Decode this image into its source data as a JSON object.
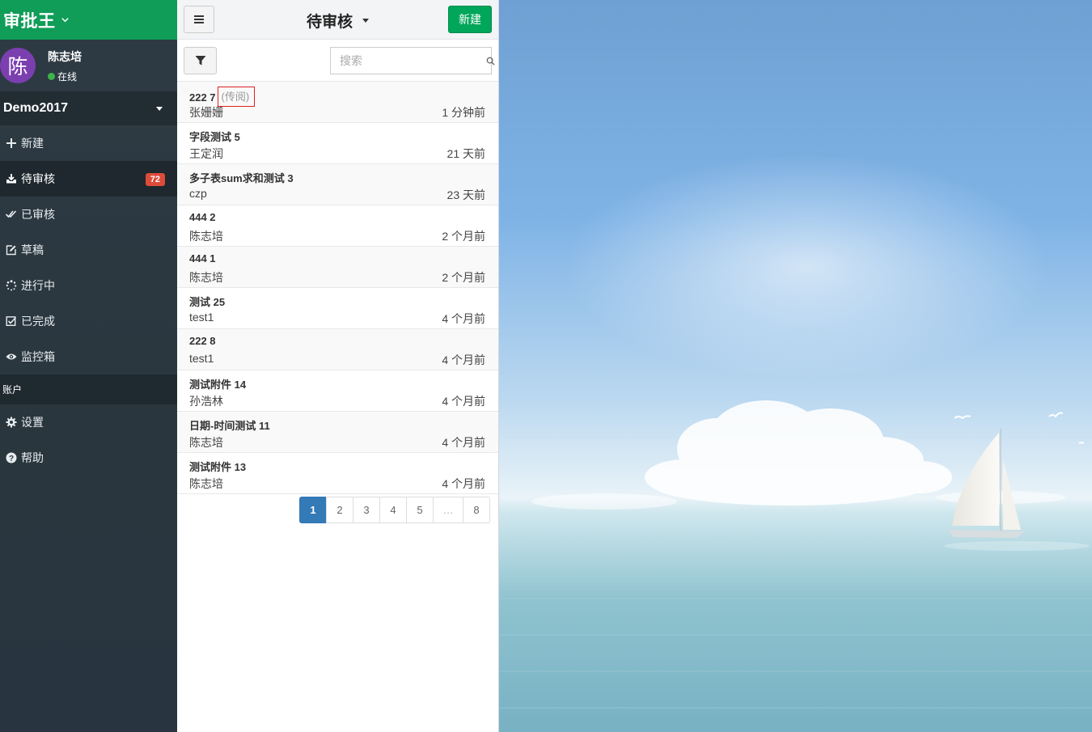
{
  "app": {
    "brand": "审批王"
  },
  "user": {
    "avatar_char": "陈",
    "name": "陈志培",
    "status": "在线"
  },
  "org": {
    "name": "Demo2017"
  },
  "nav": [
    {
      "label": "新建",
      "icon": "plus-icon"
    },
    {
      "label": "待审核",
      "icon": "inbox-download-icon",
      "badge": "72",
      "active": true
    },
    {
      "label": "已审核",
      "icon": "double-check-icon"
    },
    {
      "label": "草稿",
      "icon": "edit-icon"
    },
    {
      "label": "进行中",
      "icon": "spinner-icon"
    },
    {
      "label": "已完成",
      "icon": "checkbox-icon"
    },
    {
      "label": "监控箱",
      "icon": "eye-icon"
    }
  ],
  "account_section": {
    "header": "账户"
  },
  "account_nav": [
    {
      "label": "设置",
      "icon": "gear-icon"
    },
    {
      "label": "帮助",
      "icon": "question-icon"
    }
  ],
  "toolbar": {
    "title": "待审核",
    "new_label": "新建"
  },
  "search": {
    "placeholder": "搜索",
    "value": ""
  },
  "items": [
    {
      "title": "222 7",
      "tag": "(传阅)",
      "submitter": "张姗姗",
      "time": "1 分钟前"
    },
    {
      "title": "字段测试 5",
      "tag": "",
      "submitter": "王定润",
      "time": "21 天前"
    },
    {
      "title": "多子表sum求和测试 3",
      "tag": "",
      "submitter": "czp",
      "time": "23 天前"
    },
    {
      "title": "444 2",
      "tag": "",
      "submitter": "陈志培",
      "time": "2 个月前"
    },
    {
      "title": "444 1",
      "tag": "",
      "submitter": "陈志培",
      "time": "2 个月前"
    },
    {
      "title": "测试 25",
      "tag": "",
      "submitter": "test1",
      "time": "4 个月前"
    },
    {
      "title": "222 8",
      "tag": "",
      "submitter": "test1",
      "time": "4 个月前"
    },
    {
      "title": "测试附件 14",
      "tag": "",
      "submitter": "孙浩林",
      "time": "4 个月前"
    },
    {
      "title": "日期-时间测试 11",
      "tag": "",
      "submitter": "陈志培",
      "time": "4 个月前"
    },
    {
      "title": "测试附件 13",
      "tag": "",
      "submitter": "陈志培",
      "time": "4 个月前"
    }
  ],
  "pagination": {
    "pages": [
      "1",
      "2",
      "3",
      "4",
      "5",
      "…",
      "8"
    ],
    "current": "1"
  },
  "colors": {
    "brand_green": "#0f9d58",
    "sidebar_bg": "#2e3b44",
    "badge_red": "#dd4b39",
    "active_page": "#337ab7"
  }
}
